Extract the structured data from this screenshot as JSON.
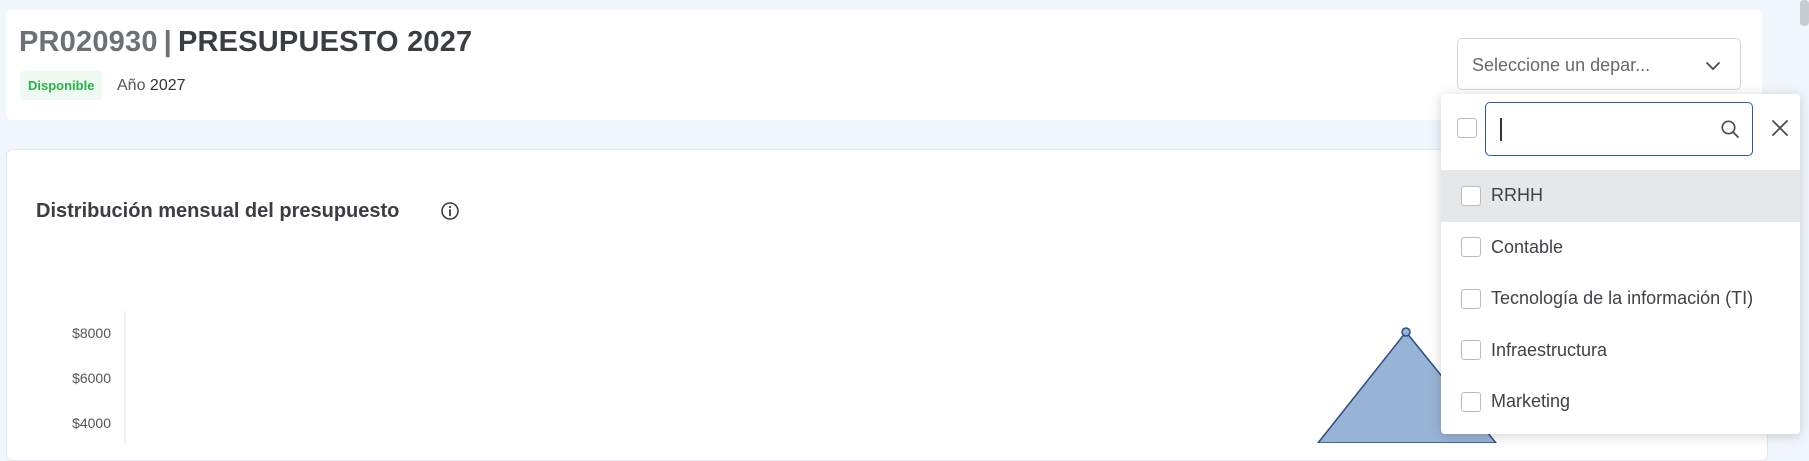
{
  "header": {
    "code": "PR020930",
    "separator": "|",
    "title": "PRESUPUESTO 2027",
    "status_badge": "Disponible",
    "year_label": "Año",
    "year_value": "2027"
  },
  "department_select": {
    "placeholder": "Seleccione un depar...",
    "icon": "chevron-down-icon"
  },
  "dropdown": {
    "search_value": "",
    "search_icon": "search-icon",
    "close_icon": "close-icon",
    "options": [
      {
        "label": "RRHH",
        "checked": false,
        "hovered": true
      },
      {
        "label": "Contable",
        "checked": false,
        "hovered": false
      },
      {
        "label": "Tecnología de la información (TI)",
        "checked": false,
        "hovered": false
      },
      {
        "label": "Infraestructura",
        "checked": false,
        "hovered": false
      },
      {
        "label": "Marketing",
        "checked": false,
        "hovered": false
      }
    ]
  },
  "chart_section": {
    "title": "Distribución mensual del presupuesto",
    "info_icon": "info-icon"
  },
  "chart_data": {
    "type": "area",
    "title": "Distribución mensual del presupuesto",
    "y_ticks": [
      "$8000",
      "$6000",
      "$4000"
    ],
    "ylim_visible": [
      4000,
      8000
    ],
    "peak_value": 8000,
    "fill_color": "#97b3d6",
    "line_color": "#2b4c86"
  },
  "colors": {
    "badge_green": "#27b24a",
    "search_border": "#2c5aa0",
    "hover_row": "#e6e7e9"
  }
}
